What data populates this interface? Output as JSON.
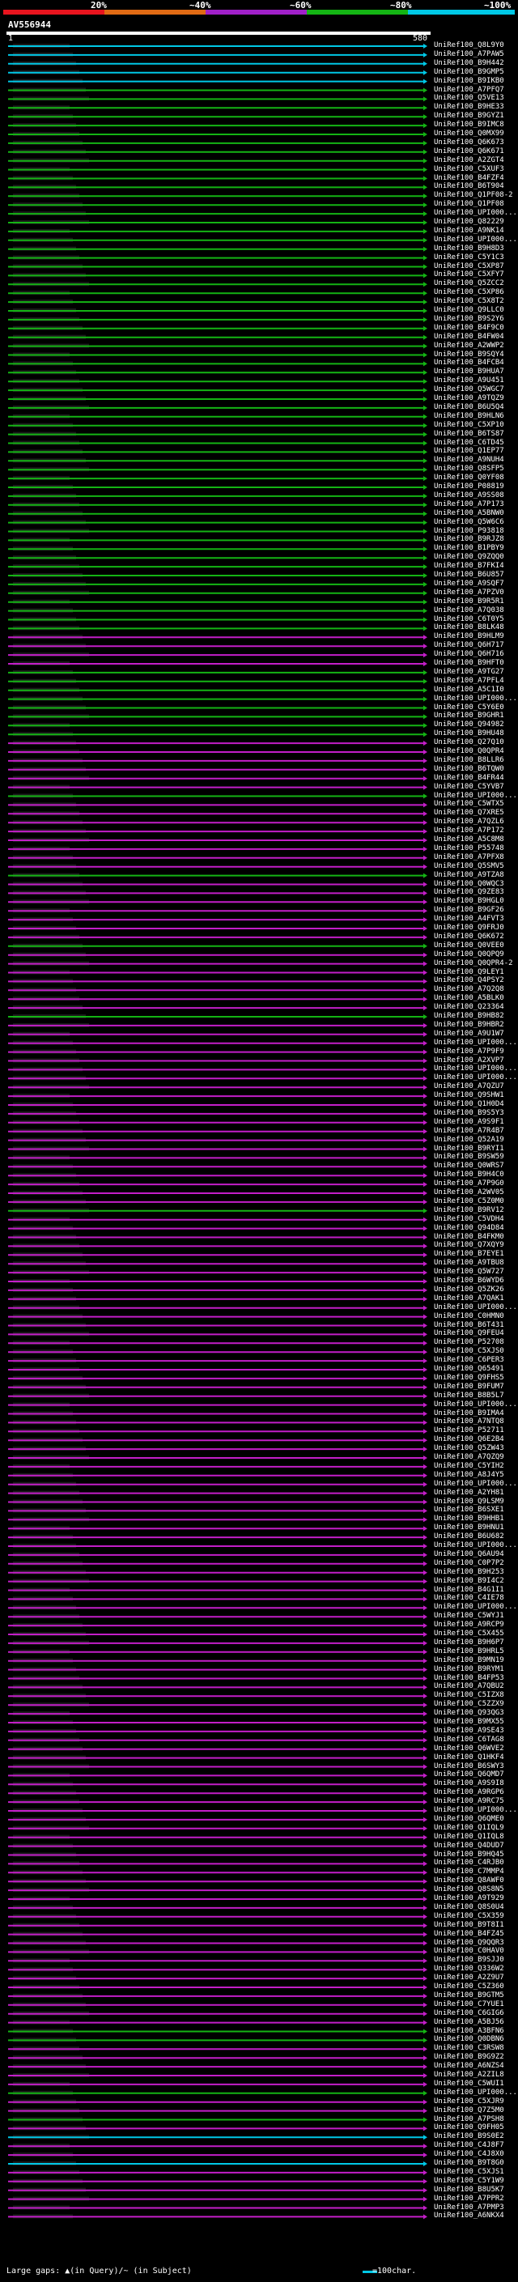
{
  "legend": {
    "segments": [
      {
        "label": "20%",
        "color": "#e8141e"
      },
      {
        "label": "~40%",
        "color": "#e06a14"
      },
      {
        "label": "~60%",
        "color": "#a020c8"
      },
      {
        "label": "~80%",
        "color": "#14b414"
      },
      {
        "label": "~100%",
        "color": "#00c8e6"
      }
    ]
  },
  "query": {
    "name": "AV556944",
    "start_label": "1",
    "end_label": "580"
  },
  "colors": {
    "cyan": "#00c8e6",
    "green": "#14b414",
    "magenta": "#c31ec8",
    "background": "#000000"
  },
  "hits": [
    {
      "label": "UniRef100_Q8L9Y0",
      "color": "cyan"
    },
    {
      "label": "UniRef100_A7PAW5",
      "color": "cyan"
    },
    {
      "label": "UniRef100_B9H442",
      "color": "cyan"
    },
    {
      "label": "UniRef100_B9GMP5",
      "color": "cyan"
    },
    {
      "label": "UniRef100_B9IKB0",
      "color": "cyan"
    },
    {
      "label": "UniRef100_A7PFQ7",
      "color": "green"
    },
    {
      "label": "UniRef100_Q5VE13",
      "color": "green"
    },
    {
      "label": "UniRef100_B9HE33",
      "color": "green"
    },
    {
      "label": "UniRef100_B9GYZ1",
      "color": "green"
    },
    {
      "label": "UniRef100_B9IMC8",
      "color": "green"
    },
    {
      "label": "UniRef100_Q0MX99",
      "color": "green"
    },
    {
      "label": "UniRef100_Q6K673",
      "color": "green"
    },
    {
      "label": "UniRef100_Q6K671",
      "color": "green"
    },
    {
      "label": "UniRef100_A2ZGT4",
      "color": "green"
    },
    {
      "label": "UniRef100_C5XUF3",
      "color": "green"
    },
    {
      "label": "UniRef100_B4FZF4",
      "color": "green"
    },
    {
      "label": "UniRef100_B6T904",
      "color": "green"
    },
    {
      "label": "UniRef100_Q1PF08-2",
      "color": "green"
    },
    {
      "label": "UniRef100_Q1PF08",
      "color": "green"
    },
    {
      "label": "UniRef100_UPI000...",
      "color": "green"
    },
    {
      "label": "UniRef100_Q82229",
      "color": "green"
    },
    {
      "label": "UniRef100_A9NK14",
      "color": "green"
    },
    {
      "label": "UniRef100_UPI000...",
      "color": "green"
    },
    {
      "label": "UniRef100_B9H8D3",
      "color": "green"
    },
    {
      "label": "UniRef100_C5Y1C3",
      "color": "green"
    },
    {
      "label": "UniRef100_C5XP87",
      "color": "green"
    },
    {
      "label": "UniRef100_C5XFY7",
      "color": "green"
    },
    {
      "label": "UniRef100_Q5ZCC2",
      "color": "green"
    },
    {
      "label": "UniRef100_C5XP86",
      "color": "green"
    },
    {
      "label": "UniRef100_C5X8T2",
      "color": "green"
    },
    {
      "label": "UniRef100_Q9LLC0",
      "color": "green"
    },
    {
      "label": "UniRef100_B9S2Y6",
      "color": "green"
    },
    {
      "label": "UniRef100_B4F9C0",
      "color": "green"
    },
    {
      "label": "UniRef100_B4FW04",
      "color": "green"
    },
    {
      "label": "UniRef100_A2WWP2",
      "color": "green"
    },
    {
      "label": "UniRef100_B9SQY4",
      "color": "green"
    },
    {
      "label": "UniRef100_B4FCB4",
      "color": "green"
    },
    {
      "label": "UniRef100_B9HUA7",
      "color": "green"
    },
    {
      "label": "UniRef100_A9U451",
      "color": "green"
    },
    {
      "label": "UniRef100_Q5WGC7",
      "color": "green"
    },
    {
      "label": "UniRef100_A9TQZ9",
      "color": "green"
    },
    {
      "label": "UniRef100_B6U5Q4",
      "color": "green"
    },
    {
      "label": "UniRef100_B9HLN6",
      "color": "green"
    },
    {
      "label": "UniRef100_C5XP10",
      "color": "green"
    },
    {
      "label": "UniRef100_B6TS87",
      "color": "green"
    },
    {
      "label": "UniRef100_C6TD45",
      "color": "green"
    },
    {
      "label": "UniRef100_Q1EP77",
      "color": "green"
    },
    {
      "label": "UniRef100_A9NUH4",
      "color": "green"
    },
    {
      "label": "UniRef100_Q8SFP5",
      "color": "green"
    },
    {
      "label": "UniRef100_Q0YF08",
      "color": "green"
    },
    {
      "label": "UniRef100_P08819",
      "color": "green"
    },
    {
      "label": "UniRef100_A9SS08",
      "color": "green"
    },
    {
      "label": "UniRef100_A7P173",
      "color": "green"
    },
    {
      "label": "UniRef100_A5BNW0",
      "color": "green"
    },
    {
      "label": "UniRef100_Q5W6C6",
      "color": "green"
    },
    {
      "label": "UniRef100_P93818",
      "color": "green"
    },
    {
      "label": "UniRef100_B9RJZ8",
      "color": "green"
    },
    {
      "label": "UniRef100_B1PBY9",
      "color": "green"
    },
    {
      "label": "UniRef100_Q9ZQQ0",
      "color": "green"
    },
    {
      "label": "UniRef100_B7FKI4",
      "color": "green"
    },
    {
      "label": "UniRef100_B6U857",
      "color": "green"
    },
    {
      "label": "UniRef100_A9SQF7",
      "color": "green"
    },
    {
      "label": "UniRef100_A7PZV0",
      "color": "green"
    },
    {
      "label": "UniRef100_B9R5R1",
      "color": "green"
    },
    {
      "label": "UniRef100_A7Q038",
      "color": "green"
    },
    {
      "label": "UniRef100_C6T0Y5",
      "color": "green"
    },
    {
      "label": "UniRef100_B8LK48",
      "color": "green"
    },
    {
      "label": "UniRef100_B9HLM9",
      "color": "magenta"
    },
    {
      "label": "UniRef100_Q6H717",
      "color": "magenta"
    },
    {
      "label": "UniRef100_Q6H716",
      "color": "magenta"
    },
    {
      "label": "UniRef100_B9HFT0",
      "color": "magenta"
    },
    {
      "label": "UniRef100_A9TG27",
      "color": "green"
    },
    {
      "label": "UniRef100_A7PFL4",
      "color": "green"
    },
    {
      "label": "UniRef100_A5C1I0",
      "color": "green"
    },
    {
      "label": "UniRef100_UPI000...",
      "color": "green"
    },
    {
      "label": "UniRef100_C5Y6E0",
      "color": "green"
    },
    {
      "label": "UniRef100_B9GHR1",
      "color": "green"
    },
    {
      "label": "UniRef100_Q94982",
      "color": "green"
    },
    {
      "label": "UniRef100_B9HU48",
      "color": "green"
    },
    {
      "label": "UniRef100_Q27Q10",
      "color": "magenta"
    },
    {
      "label": "UniRef100_Q0QPR4",
      "color": "magenta"
    },
    {
      "label": "UniRef100_B8LLR6",
      "color": "magenta"
    },
    {
      "label": "UniRef100_B6TQW0",
      "color": "magenta"
    },
    {
      "label": "UniRef100_B4FR44",
      "color": "magenta"
    },
    {
      "label": "UniRef100_C5YVB7",
      "color": "magenta"
    },
    {
      "label": "UniRef100_UPI000...",
      "color": "green"
    },
    {
      "label": "UniRef100_C5WTX5",
      "color": "magenta"
    },
    {
      "label": "UniRef100_Q7XRE5",
      "color": "magenta"
    },
    {
      "label": "UniRef100_A7QZL6",
      "color": "magenta"
    },
    {
      "label": "UniRef100_A7P172",
      "color": "magenta"
    },
    {
      "label": "UniRef100_A5C8M8",
      "color": "magenta"
    },
    {
      "label": "UniRef100_P55748",
      "color": "magenta"
    },
    {
      "label": "UniRef100_A7PFX8",
      "color": "magenta"
    },
    {
      "label": "UniRef100_Q5SMV5",
      "color": "magenta"
    },
    {
      "label": "UniRef100_A9TZA8",
      "color": "green"
    },
    {
      "label": "UniRef100_Q0WQC3",
      "color": "magenta"
    },
    {
      "label": "UniRef100_Q9ZE83",
      "color": "magenta"
    },
    {
      "label": "UniRef100_B9HGL0",
      "color": "magenta"
    },
    {
      "label": "UniRef100_B9GF26",
      "color": "magenta"
    },
    {
      "label": "UniRef100_A4FVT3",
      "color": "magenta"
    },
    {
      "label": "UniRef100_Q9FRJ0",
      "color": "magenta"
    },
    {
      "label": "UniRef100_Q6K672",
      "color": "magenta"
    },
    {
      "label": "UniRef100_Q0VEE0",
      "color": "green"
    },
    {
      "label": "UniRef100_Q0QPQ9",
      "color": "magenta"
    },
    {
      "label": "UniRef100_Q0QPR4-2",
      "color": "magenta"
    },
    {
      "label": "UniRef100_Q9LEY1",
      "color": "magenta"
    },
    {
      "label": "UniRef100_Q4PSY2",
      "color": "magenta"
    },
    {
      "label": "UniRef100_A7Q2Q8",
      "color": "magenta"
    },
    {
      "label": "UniRef100_A5BLK0",
      "color": "magenta"
    },
    {
      "label": "UniRef100_Q23364",
      "color": "magenta"
    },
    {
      "label": "UniRef100_B9HB82",
      "color": "green"
    },
    {
      "label": "UniRef100_B9HBR2",
      "color": "magenta"
    },
    {
      "label": "UniRef100_A9U1W7",
      "color": "magenta"
    },
    {
      "label": "UniRef100_UPI000...",
      "color": "magenta"
    },
    {
      "label": "UniRef100_A7P9F9",
      "color": "magenta"
    },
    {
      "label": "UniRef100_A2XVP7",
      "color": "magenta"
    },
    {
      "label": "UniRef100_UPI000...",
      "color": "magenta"
    },
    {
      "label": "UniRef100_UPI000...",
      "color": "magenta"
    },
    {
      "label": "UniRef100_A7QZU7",
      "color": "magenta"
    },
    {
      "label": "UniRef100_Q9SHW1",
      "color": "magenta"
    },
    {
      "label": "UniRef100_Q1H0D4",
      "color": "magenta"
    },
    {
      "label": "UniRef100_B9S5Y3",
      "color": "magenta"
    },
    {
      "label": "UniRef100_A9S9F1",
      "color": "magenta"
    },
    {
      "label": "UniRef100_A7R4B7",
      "color": "magenta"
    },
    {
      "label": "UniRef100_Q52A19",
      "color": "magenta"
    },
    {
      "label": "UniRef100_B9RYI1",
      "color": "magenta"
    },
    {
      "label": "UniRef100_B9SW59",
      "color": "magenta"
    },
    {
      "label": "UniRef100_Q0WRS7",
      "color": "magenta"
    },
    {
      "label": "UniRef100_B9H4C0",
      "color": "magenta"
    },
    {
      "label": "UniRef100_A7P9G0",
      "color": "magenta"
    },
    {
      "label": "UniRef100_A2WV05",
      "color": "magenta"
    },
    {
      "label": "UniRef100_C5Z0M0",
      "color": "magenta"
    },
    {
      "label": "UniRef100_B9RV12",
      "color": "green"
    },
    {
      "label": "UniRef100_C5VDH4",
      "color": "magenta"
    },
    {
      "label": "UniRef100_Q94D84",
      "color": "magenta"
    },
    {
      "label": "UniRef100_B4FKM0",
      "color": "magenta"
    },
    {
      "label": "UniRef100_Q7XQY9",
      "color": "magenta"
    },
    {
      "label": "UniRef100_B7EYE1",
      "color": "magenta"
    },
    {
      "label": "UniRef100_A9TBU8",
      "color": "magenta"
    },
    {
      "label": "UniRef100_Q5W727",
      "color": "magenta"
    },
    {
      "label": "UniRef100_B6WYD6",
      "color": "magenta"
    },
    {
      "label": "UniRef100_Q5ZK26",
      "color": "magenta"
    },
    {
      "label": "UniRef100_A7QAK1",
      "color": "magenta"
    },
    {
      "label": "UniRef100_UPI000...",
      "color": "magenta"
    },
    {
      "label": "UniRef100_C0HMN0",
      "color": "magenta"
    },
    {
      "label": "UniRef100_B6T431",
      "color": "magenta"
    },
    {
      "label": "UniRef100_Q9FEU4",
      "color": "magenta"
    },
    {
      "label": "UniRef100_P52708",
      "color": "magenta"
    },
    {
      "label": "UniRef100_C5XJS0",
      "color": "magenta"
    },
    {
      "label": "UniRef100_C6PER3",
      "color": "magenta"
    },
    {
      "label": "UniRef100_Q65491",
      "color": "magenta"
    },
    {
      "label": "UniRef100_Q9FHS5",
      "color": "magenta"
    },
    {
      "label": "UniRef100_B9FUM7",
      "color": "magenta"
    },
    {
      "label": "UniRef100_B8B5L7",
      "color": "magenta"
    },
    {
      "label": "UniRef100_UPI000...",
      "color": "magenta"
    },
    {
      "label": "UniRef100_B9IMA4",
      "color": "magenta"
    },
    {
      "label": "UniRef100_A7NTQ8",
      "color": "magenta"
    },
    {
      "label": "UniRef100_P52711",
      "color": "magenta"
    },
    {
      "label": "UniRef100_Q6E2B4",
      "color": "magenta"
    },
    {
      "label": "UniRef100_Q5ZW43",
      "color": "magenta"
    },
    {
      "label": "UniRef100_A7QZQ9",
      "color": "magenta"
    },
    {
      "label": "UniRef100_C5YIH2",
      "color": "magenta"
    },
    {
      "label": "UniRef100_A8J4Y5",
      "color": "magenta"
    },
    {
      "label": "UniRef100_UPI000...",
      "color": "magenta"
    },
    {
      "label": "UniRef100_A2YH81",
      "color": "magenta"
    },
    {
      "label": "UniRef100_Q9LSM9",
      "color": "magenta"
    },
    {
      "label": "UniRef100_B6SXE1",
      "color": "magenta"
    },
    {
      "label": "UniRef100_B9HHB1",
      "color": "magenta"
    },
    {
      "label": "UniRef100_B9HNU1",
      "color": "magenta"
    },
    {
      "label": "UniRef100_B6U682",
      "color": "magenta"
    },
    {
      "label": "UniRef100_UPI000...",
      "color": "magenta"
    },
    {
      "label": "UniRef100_Q6AU94",
      "color": "magenta"
    },
    {
      "label": "UniRef100_C0P7P2",
      "color": "magenta"
    },
    {
      "label": "UniRef100_B9H253",
      "color": "magenta"
    },
    {
      "label": "UniRef100_B9I4C2",
      "color": "magenta"
    },
    {
      "label": "UniRef100_B4G1I1",
      "color": "magenta"
    },
    {
      "label": "UniRef100_C4IE78",
      "color": "magenta"
    },
    {
      "label": "UniRef100_UPI000...",
      "color": "magenta"
    },
    {
      "label": "UniRef100_C5WYJ1",
      "color": "magenta"
    },
    {
      "label": "UniRef100_A9RCP9",
      "color": "magenta"
    },
    {
      "label": "UniRef100_C5X455",
      "color": "magenta"
    },
    {
      "label": "UniRef100_B9H6P7",
      "color": "magenta"
    },
    {
      "label": "UniRef100_B9HRL5",
      "color": "magenta"
    },
    {
      "label": "UniRef100_B9MN19",
      "color": "magenta"
    },
    {
      "label": "UniRef100_B9RYM1",
      "color": "magenta"
    },
    {
      "label": "UniRef100_B4FP53",
      "color": "magenta"
    },
    {
      "label": "UniRef100_A7QBU2",
      "color": "magenta"
    },
    {
      "label": "UniRef100_C5IZX8",
      "color": "magenta"
    },
    {
      "label": "UniRef100_C5ZZX9",
      "color": "magenta"
    },
    {
      "label": "UniRef100_Q93QG3",
      "color": "magenta"
    },
    {
      "label": "UniRef100_B9MX55",
      "color": "magenta"
    },
    {
      "label": "UniRef100_A9SE43",
      "color": "magenta"
    },
    {
      "label": "UniRef100_C6TAG8",
      "color": "magenta"
    },
    {
      "label": "UniRef100_Q6WVE2",
      "color": "magenta"
    },
    {
      "label": "UniRef100_Q1HKF4",
      "color": "magenta"
    },
    {
      "label": "UniRef100_B6SWY3",
      "color": "magenta"
    },
    {
      "label": "UniRef100_Q6QMD7",
      "color": "magenta"
    },
    {
      "label": "UniRef100_A9S9I8",
      "color": "magenta"
    },
    {
      "label": "UniRef100_A9RGP6",
      "color": "magenta"
    },
    {
      "label": "UniRef100_A9RC75",
      "color": "magenta"
    },
    {
      "label": "UniRef100_UPI000...",
      "color": "magenta"
    },
    {
      "label": "UniRef100_Q6QME0",
      "color": "magenta"
    },
    {
      "label": "UniRef100_Q1IQL9",
      "color": "magenta"
    },
    {
      "label": "UniRef100_Q1IQL8",
      "color": "magenta"
    },
    {
      "label": "UniRef100_Q4DUD7",
      "color": "magenta"
    },
    {
      "label": "UniRef100_B9HQ45",
      "color": "magenta"
    },
    {
      "label": "UniRef100_C4RJB0",
      "color": "magenta"
    },
    {
      "label": "UniRef100_C7MMP4",
      "color": "magenta"
    },
    {
      "label": "UniRef100_Q8AWF0",
      "color": "magenta"
    },
    {
      "label": "UniRef100_Q8S8N5",
      "color": "magenta"
    },
    {
      "label": "UniRef100_A9T929",
      "color": "magenta"
    },
    {
      "label": "UniRef100_Q8S0U4",
      "color": "magenta"
    },
    {
      "label": "UniRef100_C5X359",
      "color": "magenta"
    },
    {
      "label": "UniRef100_B9T8I1",
      "color": "magenta"
    },
    {
      "label": "UniRef100_B4FZ45",
      "color": "magenta"
    },
    {
      "label": "UniRef100_Q9QQR3",
      "color": "magenta"
    },
    {
      "label": "UniRef100_C0HAV0",
      "color": "magenta"
    },
    {
      "label": "UniRef100_B9SJJ0",
      "color": "magenta"
    },
    {
      "label": "UniRef100_Q336W2",
      "color": "magenta"
    },
    {
      "label": "UniRef100_A2Z9U7",
      "color": "magenta"
    },
    {
      "label": "UniRef100_C5Z360",
      "color": "magenta"
    },
    {
      "label": "UniRef100_B9GTM5",
      "color": "magenta"
    },
    {
      "label": "UniRef100_C7YUE1",
      "color": "magenta"
    },
    {
      "label": "UniRef100_C6GIG6",
      "color": "magenta"
    },
    {
      "label": "UniRef100_A5BJ56",
      "color": "magenta"
    },
    {
      "label": "UniRef100_A3BFN6",
      "color": "green"
    },
    {
      "label": "UniRef100_Q0DBN6",
      "color": "green"
    },
    {
      "label": "UniRef100_C3RSW8",
      "color": "magenta"
    },
    {
      "label": "UniRef100_B9G9Z2",
      "color": "magenta"
    },
    {
      "label": "UniRef100_A6NZS4",
      "color": "magenta"
    },
    {
      "label": "UniRef100_A2ZIL8",
      "color": "magenta"
    },
    {
      "label": "UniRef100_C5WUI1",
      "color": "magenta"
    },
    {
      "label": "UniRef100_UPI000...",
      "color": "green"
    },
    {
      "label": "UniRef100_C5XJR9",
      "color": "magenta"
    },
    {
      "label": "UniRef100_Q7Z5M0",
      "color": "magenta"
    },
    {
      "label": "UniRef100_A7PSH8",
      "color": "green"
    },
    {
      "label": "UniRef100_Q9FH05",
      "color": "magenta"
    },
    {
      "label": "UniRef100_B9S0E2",
      "color": "cyan"
    },
    {
      "label": "UniRef100_C4J8F7",
      "color": "magenta"
    },
    {
      "label": "UniRef100_C4J8X0",
      "color": "magenta"
    },
    {
      "label": "UniRef100_B9T8G0",
      "color": "cyan"
    },
    {
      "label": "UniRef100_C5XJS1",
      "color": "magenta"
    },
    {
      "label": "UniRef100_C5Y1W9",
      "color": "magenta"
    },
    {
      "label": "UniRef100_B8U5K7",
      "color": "magenta"
    },
    {
      "label": "UniRef100_A7PPR2",
      "color": "magenta"
    },
    {
      "label": "UniRef100_A7PMP3",
      "color": "magenta"
    },
    {
      "label": "UniRef100_A6NKX4",
      "color": "magenta"
    }
  ],
  "footer": {
    "left": "Large gaps: ▲(in Query)/~ (in Subject)",
    "right": "=100char."
  }
}
